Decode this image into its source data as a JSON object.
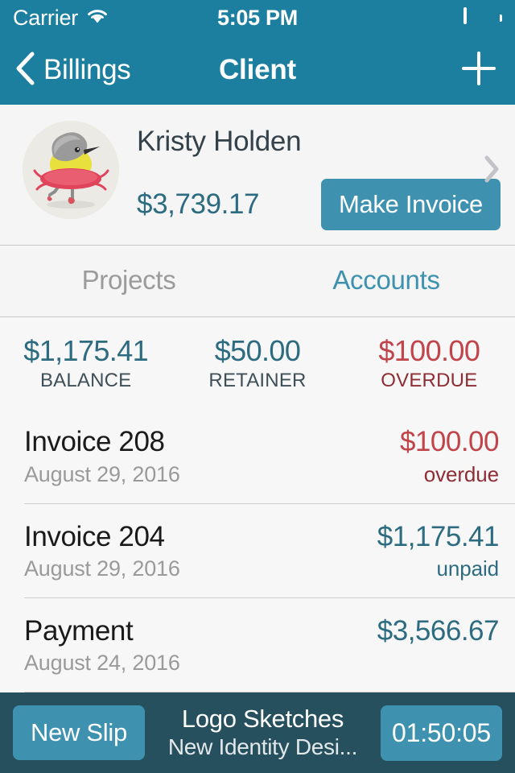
{
  "status_bar": {
    "carrier": "Carrier",
    "wifi_icon": "wifi-icon",
    "time": "5:05 PM",
    "battery_icon": "battery-icon"
  },
  "nav_bar": {
    "back_icon": "chevron-left-icon",
    "back_label": "Billings",
    "title": "Client",
    "add_icon": "plus-icon"
  },
  "client": {
    "avatar_icon": "client-avatar-bird-in-tutu",
    "name": "Kristy Holden",
    "total": "$3,739.17",
    "make_invoice_label": "Make Invoice",
    "disclosure_icon": "chevron-right-icon"
  },
  "tabs": [
    {
      "label": "Projects",
      "active": false
    },
    {
      "label": "Accounts",
      "active": true
    }
  ],
  "summary": [
    {
      "amount": "$1,175.41",
      "label": "BALANCE",
      "tone": "teal"
    },
    {
      "amount": "$50.00",
      "label": "RETAINER",
      "tone": "teal"
    },
    {
      "amount": "$100.00",
      "label": "OVERDUE",
      "tone": "red"
    }
  ],
  "transactions": [
    {
      "title": "Invoice 208",
      "date": "August 29, 2016",
      "amount": "$100.00",
      "status": "overdue",
      "tone": "red"
    },
    {
      "title": "Invoice 204",
      "date": "August 29, 2016",
      "amount": "$1,175.41",
      "status": "unpaid",
      "tone": "teal"
    },
    {
      "title": "Payment",
      "date": "August 24, 2016",
      "amount": "$3,566.67",
      "status": "",
      "tone": "teal"
    }
  ],
  "timer_bar": {
    "new_slip_label": "New Slip",
    "task_title": "Logo Sketches",
    "task_subtitle": "New Identity Desi...",
    "elapsed": "01:50:05"
  },
  "colors": {
    "nav_teal": "#1d7fa0",
    "accent_teal": "#3e92af",
    "text_teal": "#2c6b80",
    "danger_red": "#c0444a",
    "danger_red_dark": "#8e2d33",
    "bottom_bar": "#26505e",
    "page_bg": "#f5f5f5"
  }
}
